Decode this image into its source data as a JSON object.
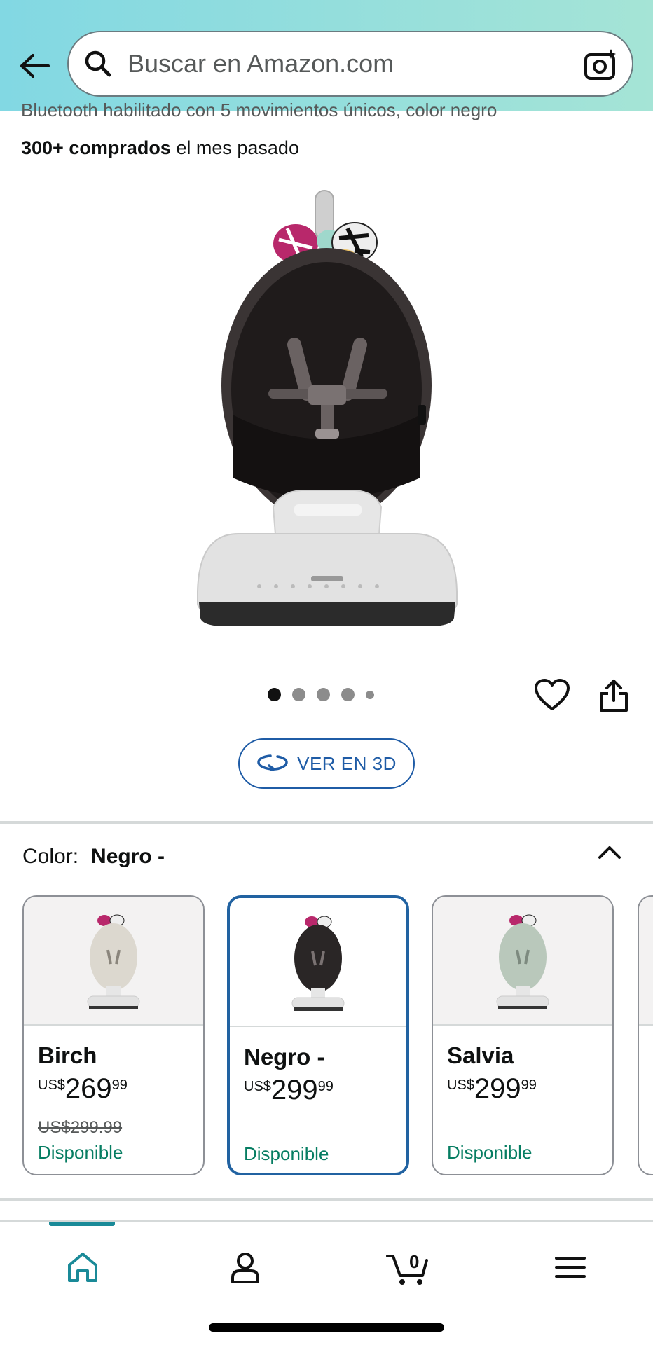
{
  "header": {
    "search_placeholder": "Buscar en Amazon.com"
  },
  "product": {
    "title_cut": "Bluetooth habilitado con 5 movimientos únicos, color negro",
    "bought_bold": "300+ comprados",
    "bought_rest": " el mes pasado",
    "image_icon": "baby-swing-image",
    "carousel": {
      "count": 5,
      "active": 1
    },
    "view3d_label": "VER EN 3D"
  },
  "color": {
    "label": "Color:",
    "selected_value": "Negro -",
    "options": [
      {
        "name": "Birch",
        "currency": "US$",
        "whole": "269",
        "cents": "99",
        "was": "US$299.99",
        "availability": "Disponible",
        "seat_color": "#dcd8cf"
      },
      {
        "name": "Negro -",
        "currency": "US$",
        "whole": "299",
        "cents": "99",
        "was": "",
        "availability": "Disponible",
        "seat_color": "#2a2626"
      },
      {
        "name": "Salvia",
        "currency": "US$",
        "whole": "299",
        "cents": "99",
        "was": "",
        "availability": "Disponible",
        "seat_color": "#b9c8bb"
      }
    ]
  },
  "nav": {
    "cart_count": "0",
    "items": [
      "home-icon",
      "account-icon",
      "cart-icon",
      "menu-icon"
    ],
    "accent": "#1a8a98"
  },
  "colors": {
    "link_blue": "#1f5ca6",
    "available_green": "#067d62",
    "selected_border": "#2162a1"
  }
}
